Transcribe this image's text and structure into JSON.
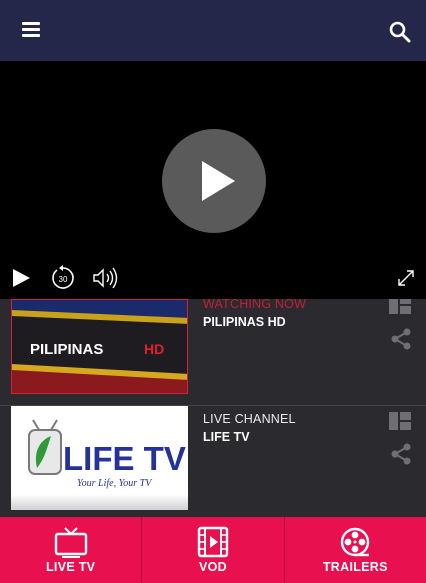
{
  "header": {
    "menu_icon": "hamburger-menu-icon",
    "search_icon": "search-icon",
    "background_color": "#24264a"
  },
  "player": {
    "big_play_icon": "play-circle-icon",
    "controls": [
      "play-icon",
      "rewind-30-icon",
      "volume-icon",
      "fullscreen-icon"
    ],
    "rewind_seconds": "30"
  },
  "channels": [
    {
      "status": "WATCHING NOW",
      "name": "PILIPINAS HD",
      "thumb_text": "PILIPINAS",
      "thumb_badge": "HD",
      "status_color": "#c2203a"
    },
    {
      "status": "LIVE CHANNEL",
      "name": "LIFE TV",
      "thumb_text": "LIFE TV",
      "thumb_tagline": "Your Life, Your TV",
      "status_color": "#ececec"
    }
  ],
  "bottom_nav": {
    "background_color": "#e8104f",
    "tabs": [
      {
        "label": "LIVE TV",
        "icon": "tv-icon"
      },
      {
        "label": "VOD",
        "icon": "film-icon"
      },
      {
        "label": "TRAILERS",
        "icon": "film-reel-icon"
      }
    ]
  }
}
